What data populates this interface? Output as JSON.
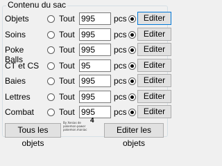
{
  "group": {
    "title": "Contenu du sac"
  },
  "rows": [
    {
      "label": "Objets",
      "all_label": "Tout",
      "quantity": "995",
      "unit": "pcs",
      "button": "Editer"
    },
    {
      "label": "Soins",
      "all_label": "Tout",
      "quantity": "995",
      "unit": "pcs",
      "button": "Editer"
    },
    {
      "label": "Poke Balls",
      "all_label": "Tout",
      "quantity": "995",
      "unit": "pcs",
      "button": "Editer"
    },
    {
      "label": "CT et CS",
      "all_label": "Tout",
      "quantity": "95",
      "unit": "pcs",
      "button": "Editer"
    },
    {
      "label": "Baies",
      "all_label": "Tout",
      "quantity": "995",
      "unit": "pcs",
      "button": "Editer"
    },
    {
      "label": "Lettres",
      "all_label": "Tout",
      "quantity": "995",
      "unit": "pcs",
      "button": "Editer"
    },
    {
      "label": "Combat",
      "all_label": "Tout",
      "quantity": "995",
      "unit": "pcs",
      "button": "Editer"
    }
  ],
  "bottom": {
    "all_objects_button": "Tous les objets",
    "edit_objects_button": "Editer les objets",
    "note_lines": [
      "By Xenias de",
      "pokemon-power",
      "pokemon.maniac"
    ],
    "note_number": "4"
  },
  "colors": {
    "focus_border": "#0078d7",
    "button_bg": "#e1e1e1",
    "window_bg": "#f0f0f0"
  }
}
